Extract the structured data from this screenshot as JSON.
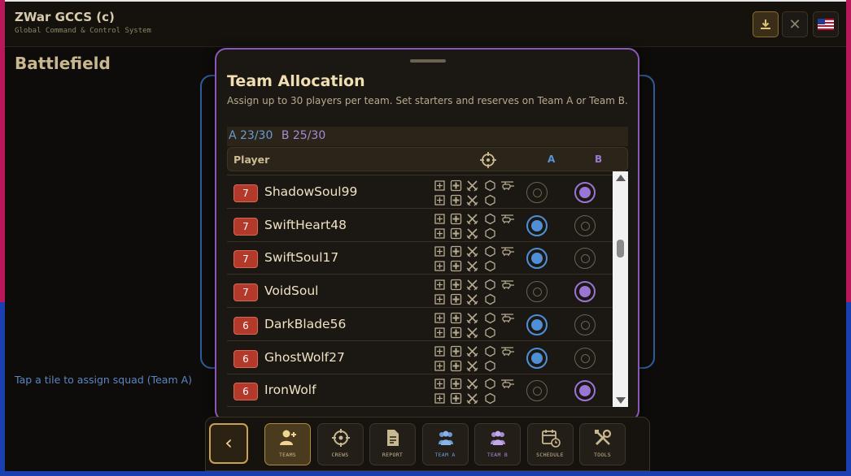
{
  "app": {
    "title": "ZWar GCCS (c)",
    "subtitle": "Global Command & Control System"
  },
  "page": {
    "title": "Battlefield",
    "hint": "Tap a tile to assign squad (Team A)"
  },
  "modal": {
    "title": "Team Allocation",
    "description": "Assign up to 30 players per team. Set starters and reserves on Team A or Team B.",
    "count_a": "A 23/30",
    "count_b": "B 25/30",
    "header": {
      "player": "Player",
      "col_a": "A",
      "col_b": "B"
    },
    "rows": [
      {
        "level": "7",
        "name": "ShadowSoul99",
        "team": "B"
      },
      {
        "level": "7",
        "name": "SwiftHeart48",
        "team": "A"
      },
      {
        "level": "7",
        "name": "SwiftSoul17",
        "team": "A"
      },
      {
        "level": "7",
        "name": "VoidSoul",
        "team": "B"
      },
      {
        "level": "6",
        "name": "DarkBlade56",
        "team": "A"
      },
      {
        "level": "6",
        "name": "GhostWolf27",
        "team": "A"
      },
      {
        "level": "6",
        "name": "IronWolf",
        "team": "B"
      }
    ]
  },
  "nav": {
    "items": [
      {
        "label": "TEAMS",
        "icon": "add-user-icon",
        "active": true
      },
      {
        "label": "CREWS",
        "icon": "crosshair-icon"
      },
      {
        "label": "REPORT",
        "icon": "document-icon"
      },
      {
        "label": "TEAM A",
        "icon": "team-icon"
      },
      {
        "label": "TEAM B",
        "icon": "team-icon"
      },
      {
        "label": "SCHEDULE",
        "icon": "calendar-clock-icon"
      },
      {
        "label": "TOOLS",
        "icon": "tools-icon"
      }
    ]
  },
  "colors": {
    "team_a": "#4f8fd6",
    "team_b": "#9a75d4",
    "accent": "#c9a24e",
    "level_badge": "#b3392b"
  }
}
